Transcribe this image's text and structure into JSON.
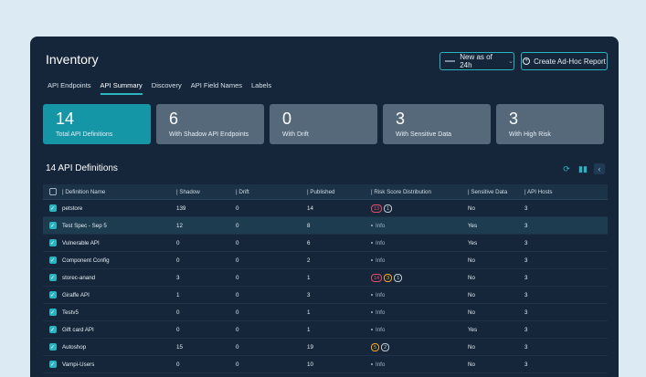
{
  "header": {
    "title": "Inventory",
    "new_as_of": "New as of 24h",
    "adhoc_label": "Create Ad-Hoc Report"
  },
  "tabs": [
    "API Endpoints",
    "API Summary",
    "Discovery",
    "API Field Names",
    "Labels"
  ],
  "active_tab": "API Summary",
  "cards": [
    {
      "num": "14",
      "label": "Total API Definitions"
    },
    {
      "num": "6",
      "label": "With Shadow API Endpoints"
    },
    {
      "num": "0",
      "label": "With Drift"
    },
    {
      "num": "3",
      "label": "With Sensitive Data"
    },
    {
      "num": "3",
      "label": "With High Risk"
    }
  ],
  "section_title": "14 API Definitions",
  "columns": [
    "| Definition Name",
    "| Shadow",
    "| Drift",
    "| Published",
    "| Risk Score Distribution",
    "| Sensitive Data",
    "| API Hosts"
  ],
  "rows": [
    {
      "name": "petstore",
      "shadow": "139",
      "drift": "0",
      "published": "14",
      "risk": [
        {
          "v": "13",
          "t": "crit"
        },
        {
          "v": "1",
          "t": "low"
        }
      ],
      "sensitive": "No",
      "hosts": "3"
    },
    {
      "name": "Test Spec - Sep 5",
      "shadow": "12",
      "drift": "0",
      "published": "8",
      "risk": "Info",
      "sensitive": "Yes",
      "hosts": "3"
    },
    {
      "name": "Vulnerable API",
      "shadow": "0",
      "drift": "0",
      "published": "6",
      "risk": "Info",
      "sensitive": "Yes",
      "hosts": "3"
    },
    {
      "name": "Component Config",
      "shadow": "0",
      "drift": "0",
      "published": "2",
      "risk": "Info",
      "sensitive": "No",
      "hosts": "3"
    },
    {
      "name": "storec-anand",
      "shadow": "3",
      "drift": "0",
      "published": "1",
      "risk": [
        {
          "v": "14",
          "t": "crit"
        },
        {
          "v": "3",
          "t": "high"
        },
        {
          "v": "1",
          "t": "low"
        }
      ],
      "sensitive": "No",
      "hosts": "3"
    },
    {
      "name": "Giraffe API",
      "shadow": "1",
      "drift": "0",
      "published": "3",
      "risk": "Info",
      "sensitive": "No",
      "hosts": "3"
    },
    {
      "name": "Testv5",
      "shadow": "0",
      "drift": "0",
      "published": "1",
      "risk": "Info",
      "sensitive": "No",
      "hosts": "3"
    },
    {
      "name": "Gift card API",
      "shadow": "0",
      "drift": "0",
      "published": "1",
      "risk": "Info",
      "sensitive": "Yes",
      "hosts": "3"
    },
    {
      "name": "Autoshop",
      "shadow": "15",
      "drift": "0",
      "published": "19",
      "risk": [
        {
          "v": "5",
          "t": "high"
        },
        {
          "v": "2",
          "t": "low"
        }
      ],
      "sensitive": "No",
      "hosts": "3"
    },
    {
      "name": "Vampi-Users",
      "shadow": "0",
      "drift": "0",
      "published": "10",
      "risk": "Info",
      "sensitive": "No",
      "hosts": "3"
    }
  ],
  "highlight_row": 1,
  "colors": {
    "accent": "#2bb3c0",
    "critical": "#e44d66",
    "high": "#f5a623",
    "panel": "#15263a"
  }
}
